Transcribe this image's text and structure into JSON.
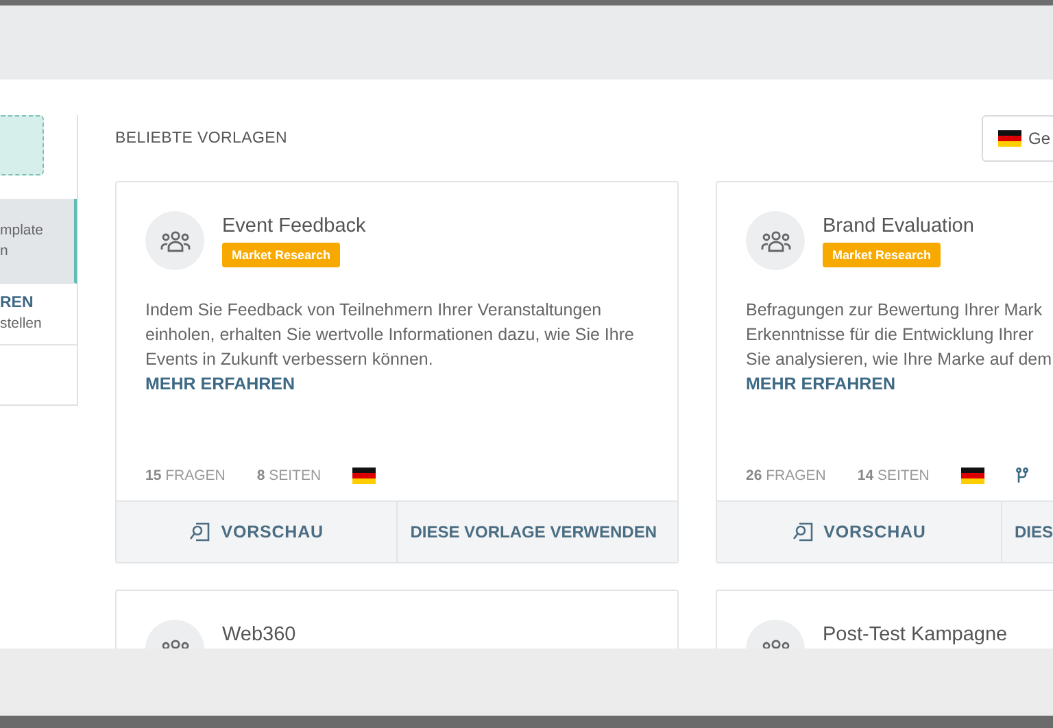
{
  "sidebar": {
    "items": [
      {
        "title": "mplate",
        "subtitle": "n",
        "selected": true
      },
      {
        "title": "REN",
        "subtitle": "stellen",
        "selected": false
      }
    ]
  },
  "section_title": "BELIEBTE VORLAGEN",
  "language_button": {
    "label": "Ge"
  },
  "cards": [
    {
      "title": "Event Feedback",
      "badge": "Market Research",
      "description_lines": [
        "Indem Sie Feedback von Teilnehmern Ihrer Veranstaltungen",
        "einholen, erhalten Sie wertvolle Informationen dazu, wie Sie Ihre",
        "Events in Zukunft verbessern können."
      ],
      "link": "MEHR ERFAHREN",
      "stats": [
        {
          "number": "15",
          "label": "FRAGEN"
        },
        {
          "number": "8",
          "label": "SEITEN"
        }
      ],
      "branching": false,
      "buttons": [
        {
          "kind": "preview",
          "label": "VORSCHAU"
        },
        {
          "kind": "use",
          "label": "DIESE VORLAGE VERWENDEN"
        }
      ]
    },
    {
      "title": "Brand Evaluation",
      "badge": "Market Research",
      "description_lines": [
        "Befragungen zur Bewertung Ihrer Mark",
        "Erkenntnisse für die Entwicklung Ihrer",
        "Sie analysieren, wie Ihre Marke auf dem"
      ],
      "link": "MEHR ERFAHREN",
      "stats": [
        {
          "number": "26",
          "label": "FRAGEN"
        },
        {
          "number": "14",
          "label": "SEITEN"
        }
      ],
      "branching": true,
      "buttons": [
        {
          "kind": "preview",
          "label": "VORSCHAU"
        },
        {
          "kind": "use",
          "label": "DIES"
        }
      ]
    },
    {
      "title": "Web360"
    },
    {
      "title": "Post-Test Kampagne"
    }
  ]
}
